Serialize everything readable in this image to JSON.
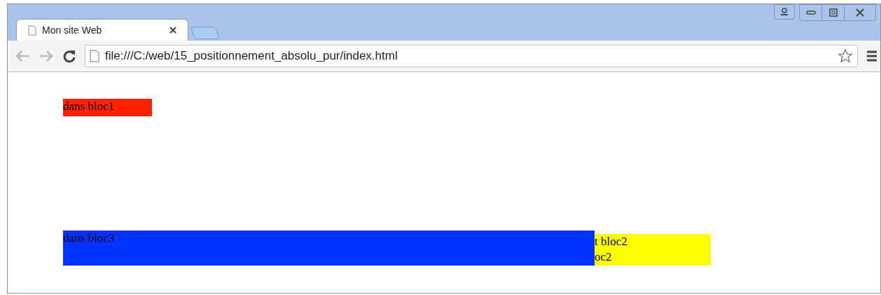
{
  "tabs": [
    {
      "title": "Mon site Web",
      "selected": true
    }
  ],
  "toolbar": {
    "back_disabled": true,
    "forward_disabled": true,
    "address": "file:///C:/web/15_positionnement_absolu_pur/index.html"
  },
  "page": {
    "blocks": [
      {
        "color": "#ff2200",
        "lines": [
          "dans bloc1"
        ]
      },
      {
        "color": "#0033ff",
        "lines": [
          "dans bloc3"
        ]
      },
      {
        "color": "#ffff00",
        "lines": [
          "t bloc2",
          "oc2"
        ]
      }
    ]
  }
}
